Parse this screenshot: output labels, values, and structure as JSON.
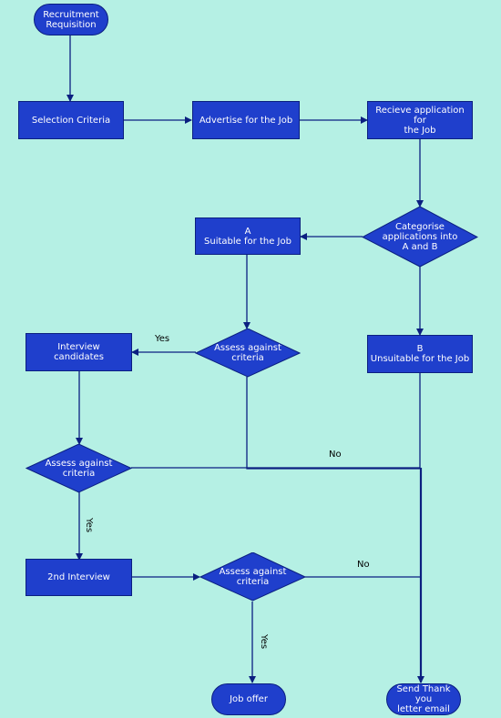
{
  "colors": {
    "background": "#b5f0e4",
    "node_fill": "#1f3fcc",
    "node_stroke": "#0b1f80",
    "connector": "#0b1f80",
    "node_text": "#ffffff"
  },
  "nodes": {
    "start": "Recruitment\nRequisition",
    "selection": "Selection Criteria",
    "advertise": "Advertise for the Job",
    "receive": "Recieve application for\nthe Job",
    "categorise": "Categorise\napplications into\nA and B",
    "suitable": "A\nSuitable for the Job",
    "unsuitable": "B\nUnsuitable for the Job",
    "assess1": "Assess against\ncriteria",
    "interview": "Interview\ncandidates",
    "assess2": "Assess against\ncriteria",
    "second_interview": "2nd Interview",
    "assess3": "Assess against\ncriteria",
    "job_offer": "Job offer",
    "thank_you": "Send Thank you\nletter email"
  },
  "labels": {
    "yes1": "Yes",
    "no1": "No",
    "yes2": "Yes",
    "no2": "No",
    "yes3": "Yes"
  }
}
